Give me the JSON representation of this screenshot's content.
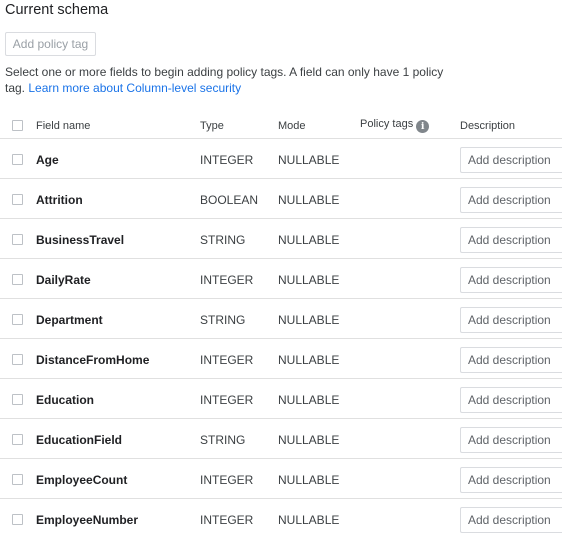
{
  "title": "Current schema",
  "add_policy_tag_label": "Add policy tag",
  "info": {
    "text": "Select one or more fields to begin adding policy tags. A field can only have 1 policy tag.",
    "link": "Learn more about Column-level security"
  },
  "headers": {
    "field_name": "Field name",
    "type": "Type",
    "mode": "Mode",
    "policy_tags": "Policy tags",
    "description": "Description"
  },
  "description_placeholder": "Add description",
  "rows": [
    {
      "name": "Age",
      "type": "INTEGER",
      "mode": "NULLABLE"
    },
    {
      "name": "Attrition",
      "type": "BOOLEAN",
      "mode": "NULLABLE"
    },
    {
      "name": "BusinessTravel",
      "type": "STRING",
      "mode": "NULLABLE"
    },
    {
      "name": "DailyRate",
      "type": "INTEGER",
      "mode": "NULLABLE"
    },
    {
      "name": "Department",
      "type": "STRING",
      "mode": "NULLABLE"
    },
    {
      "name": "DistanceFromHome",
      "type": "INTEGER",
      "mode": "NULLABLE"
    },
    {
      "name": "Education",
      "type": "INTEGER",
      "mode": "NULLABLE"
    },
    {
      "name": "EducationField",
      "type": "STRING",
      "mode": "NULLABLE"
    },
    {
      "name": "EmployeeCount",
      "type": "INTEGER",
      "mode": "NULLABLE"
    },
    {
      "name": "EmployeeNumber",
      "type": "INTEGER",
      "mode": "NULLABLE"
    }
  ]
}
